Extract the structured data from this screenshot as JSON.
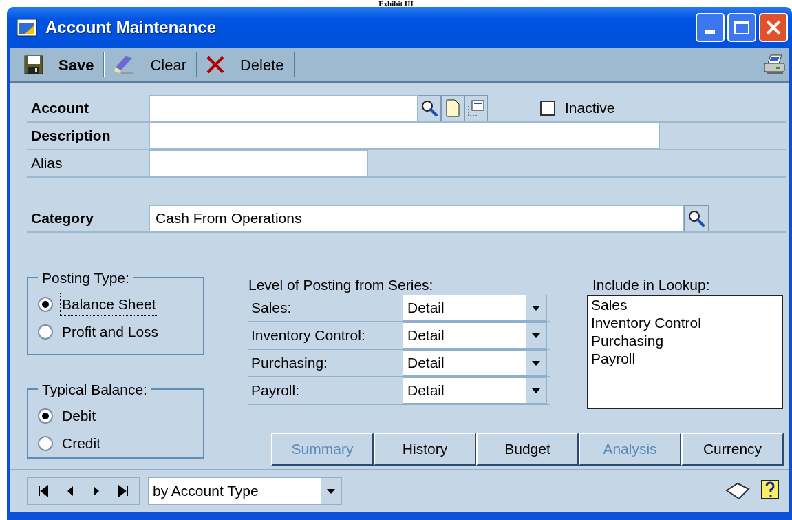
{
  "caption": "Exhibit III",
  "window": {
    "title": "Account Maintenance"
  },
  "toolbar": [
    {
      "label": "Save",
      "kind": "save"
    },
    {
      "label": "Clear",
      "kind": "clear"
    },
    {
      "label": "Delete",
      "kind": "delete"
    }
  ],
  "fields": [
    {
      "label": "Account",
      "required": true,
      "kind": "account"
    },
    {
      "label": "Description",
      "required": true,
      "kind": "wide"
    },
    {
      "label": "Alias",
      "required": false,
      "kind": "short"
    }
  ],
  "inactive": {
    "label": "Inactive",
    "checked": false
  },
  "category": {
    "label": "Category",
    "required": true,
    "value": "Cash From Operations"
  },
  "posting_type": {
    "title": "Posting Type:",
    "options": [
      {
        "label": "Balance Sheet",
        "selected": true,
        "focused": true
      },
      {
        "label": "Profit and Loss",
        "selected": false,
        "focused": false
      }
    ]
  },
  "typical_balance": {
    "title": "Typical Balance:",
    "options": [
      {
        "label": "Debit",
        "selected": true,
        "focused": false
      },
      {
        "label": "Credit",
        "selected": false,
        "focused": false
      }
    ]
  },
  "series_posting": {
    "title": "Level of Posting from Series:",
    "rows": [
      {
        "label": "Sales:",
        "value": "Detail"
      },
      {
        "label": "Inventory Control:",
        "value": "Detail"
      },
      {
        "label": "Purchasing:",
        "value": "Detail"
      },
      {
        "label": "Payroll:",
        "value": "Detail"
      }
    ]
  },
  "lookup": {
    "title": "Include in Lookup:",
    "items": [
      "Sales",
      "Inventory Control",
      "Purchasing",
      "Payroll"
    ]
  },
  "buttons": [
    {
      "label": "Summary",
      "disabled": true
    },
    {
      "label": "History",
      "disabled": false
    },
    {
      "label": "Budget",
      "disabled": false
    },
    {
      "label": "Analysis",
      "disabled": true
    },
    {
      "label": "Currency",
      "disabled": false
    }
  ],
  "footer": {
    "sort": "by Account Type"
  }
}
